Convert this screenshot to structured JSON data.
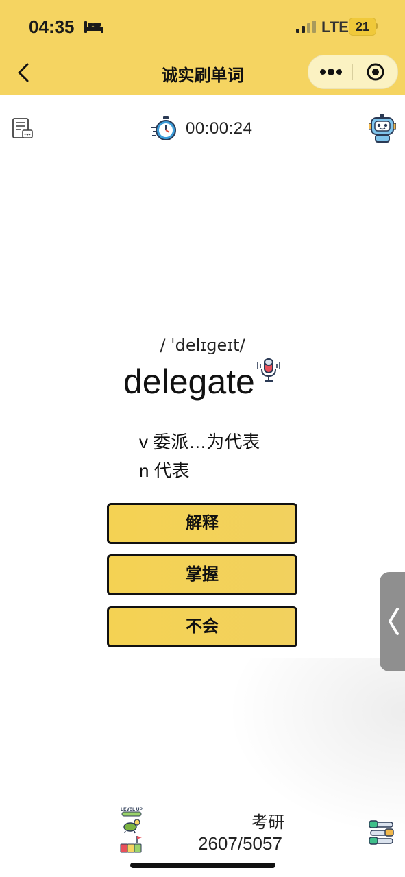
{
  "status_bar": {
    "time": "04:35",
    "network": "LTE",
    "battery": "21",
    "icons": [
      "bed-icon",
      "signal-icon"
    ]
  },
  "nav": {
    "title": "诚实刷单词",
    "back_icon": "chevron-left-icon",
    "capsule_icons": [
      "more-dots-icon",
      "close-target-icon"
    ]
  },
  "toolbar": {
    "timer": "00:00:24",
    "icons": [
      "word-list-icon",
      "stopwatch-icon",
      "robot-assistant-icon"
    ]
  },
  "card": {
    "phonetic": "/ ˈdelɪɡeɪt/",
    "word": "delegate",
    "definitions": [
      "v 委派…为代表",
      "n 代表"
    ],
    "pronounce_icon": "microphone-icon"
  },
  "actions": {
    "explain": "解释",
    "mastered": "掌握",
    "unknown": "不会"
  },
  "footer": {
    "exam": "考研",
    "progress": "2607/5057",
    "level_badge": "LEVEL UP",
    "icons": [
      "level-up-icon",
      "settings-sliders-icon"
    ]
  },
  "colors": {
    "brand_yellow": "#f5d461",
    "button_yellow": "#f4d253",
    "capsule": "#fbf2c2",
    "handle_gray": "#8f8f8f"
  }
}
